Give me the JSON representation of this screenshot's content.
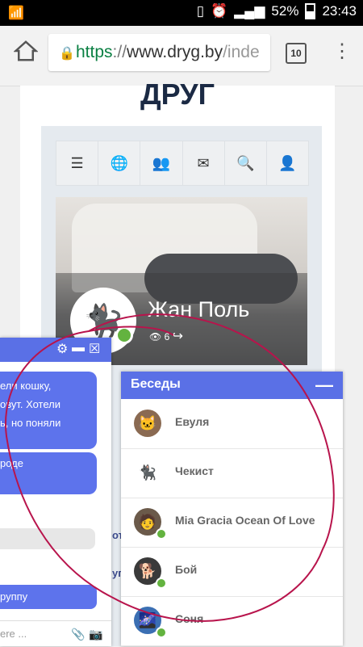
{
  "status_bar": {
    "battery": "52%",
    "time": "23:43"
  },
  "browser": {
    "url_scheme": "https",
    "url_sep": "://",
    "url_host": "www.dryg.by",
    "url_path": "/inde",
    "tab_count": "10"
  },
  "site": {
    "title": "ДРУГ"
  },
  "profile": {
    "name": "Жан Поль",
    "views": "6"
  },
  "chat": {
    "message1_lines": [
      "ели кошку,",
      "овут. Хотели",
      "ь, но поняли"
    ],
    "message2": "роде",
    "message3": "руппу",
    "input_placeholder": "ere ...",
    "behind_1": "от",
    "behind_2": "уп"
  },
  "conversations": {
    "title": "Беседы",
    "items": [
      {
        "name": "Евуля",
        "online": false
      },
      {
        "name": "Чекист",
        "online": false
      },
      {
        "name": "Mia Gracia Ocean Of Love",
        "online": true
      },
      {
        "name": "Бой",
        "online": true
      },
      {
        "name": "Соня",
        "online": true
      }
    ]
  },
  "colors": {
    "accent": "#5a70e6",
    "online": "#63b33f",
    "annotation": "#b8144c"
  }
}
